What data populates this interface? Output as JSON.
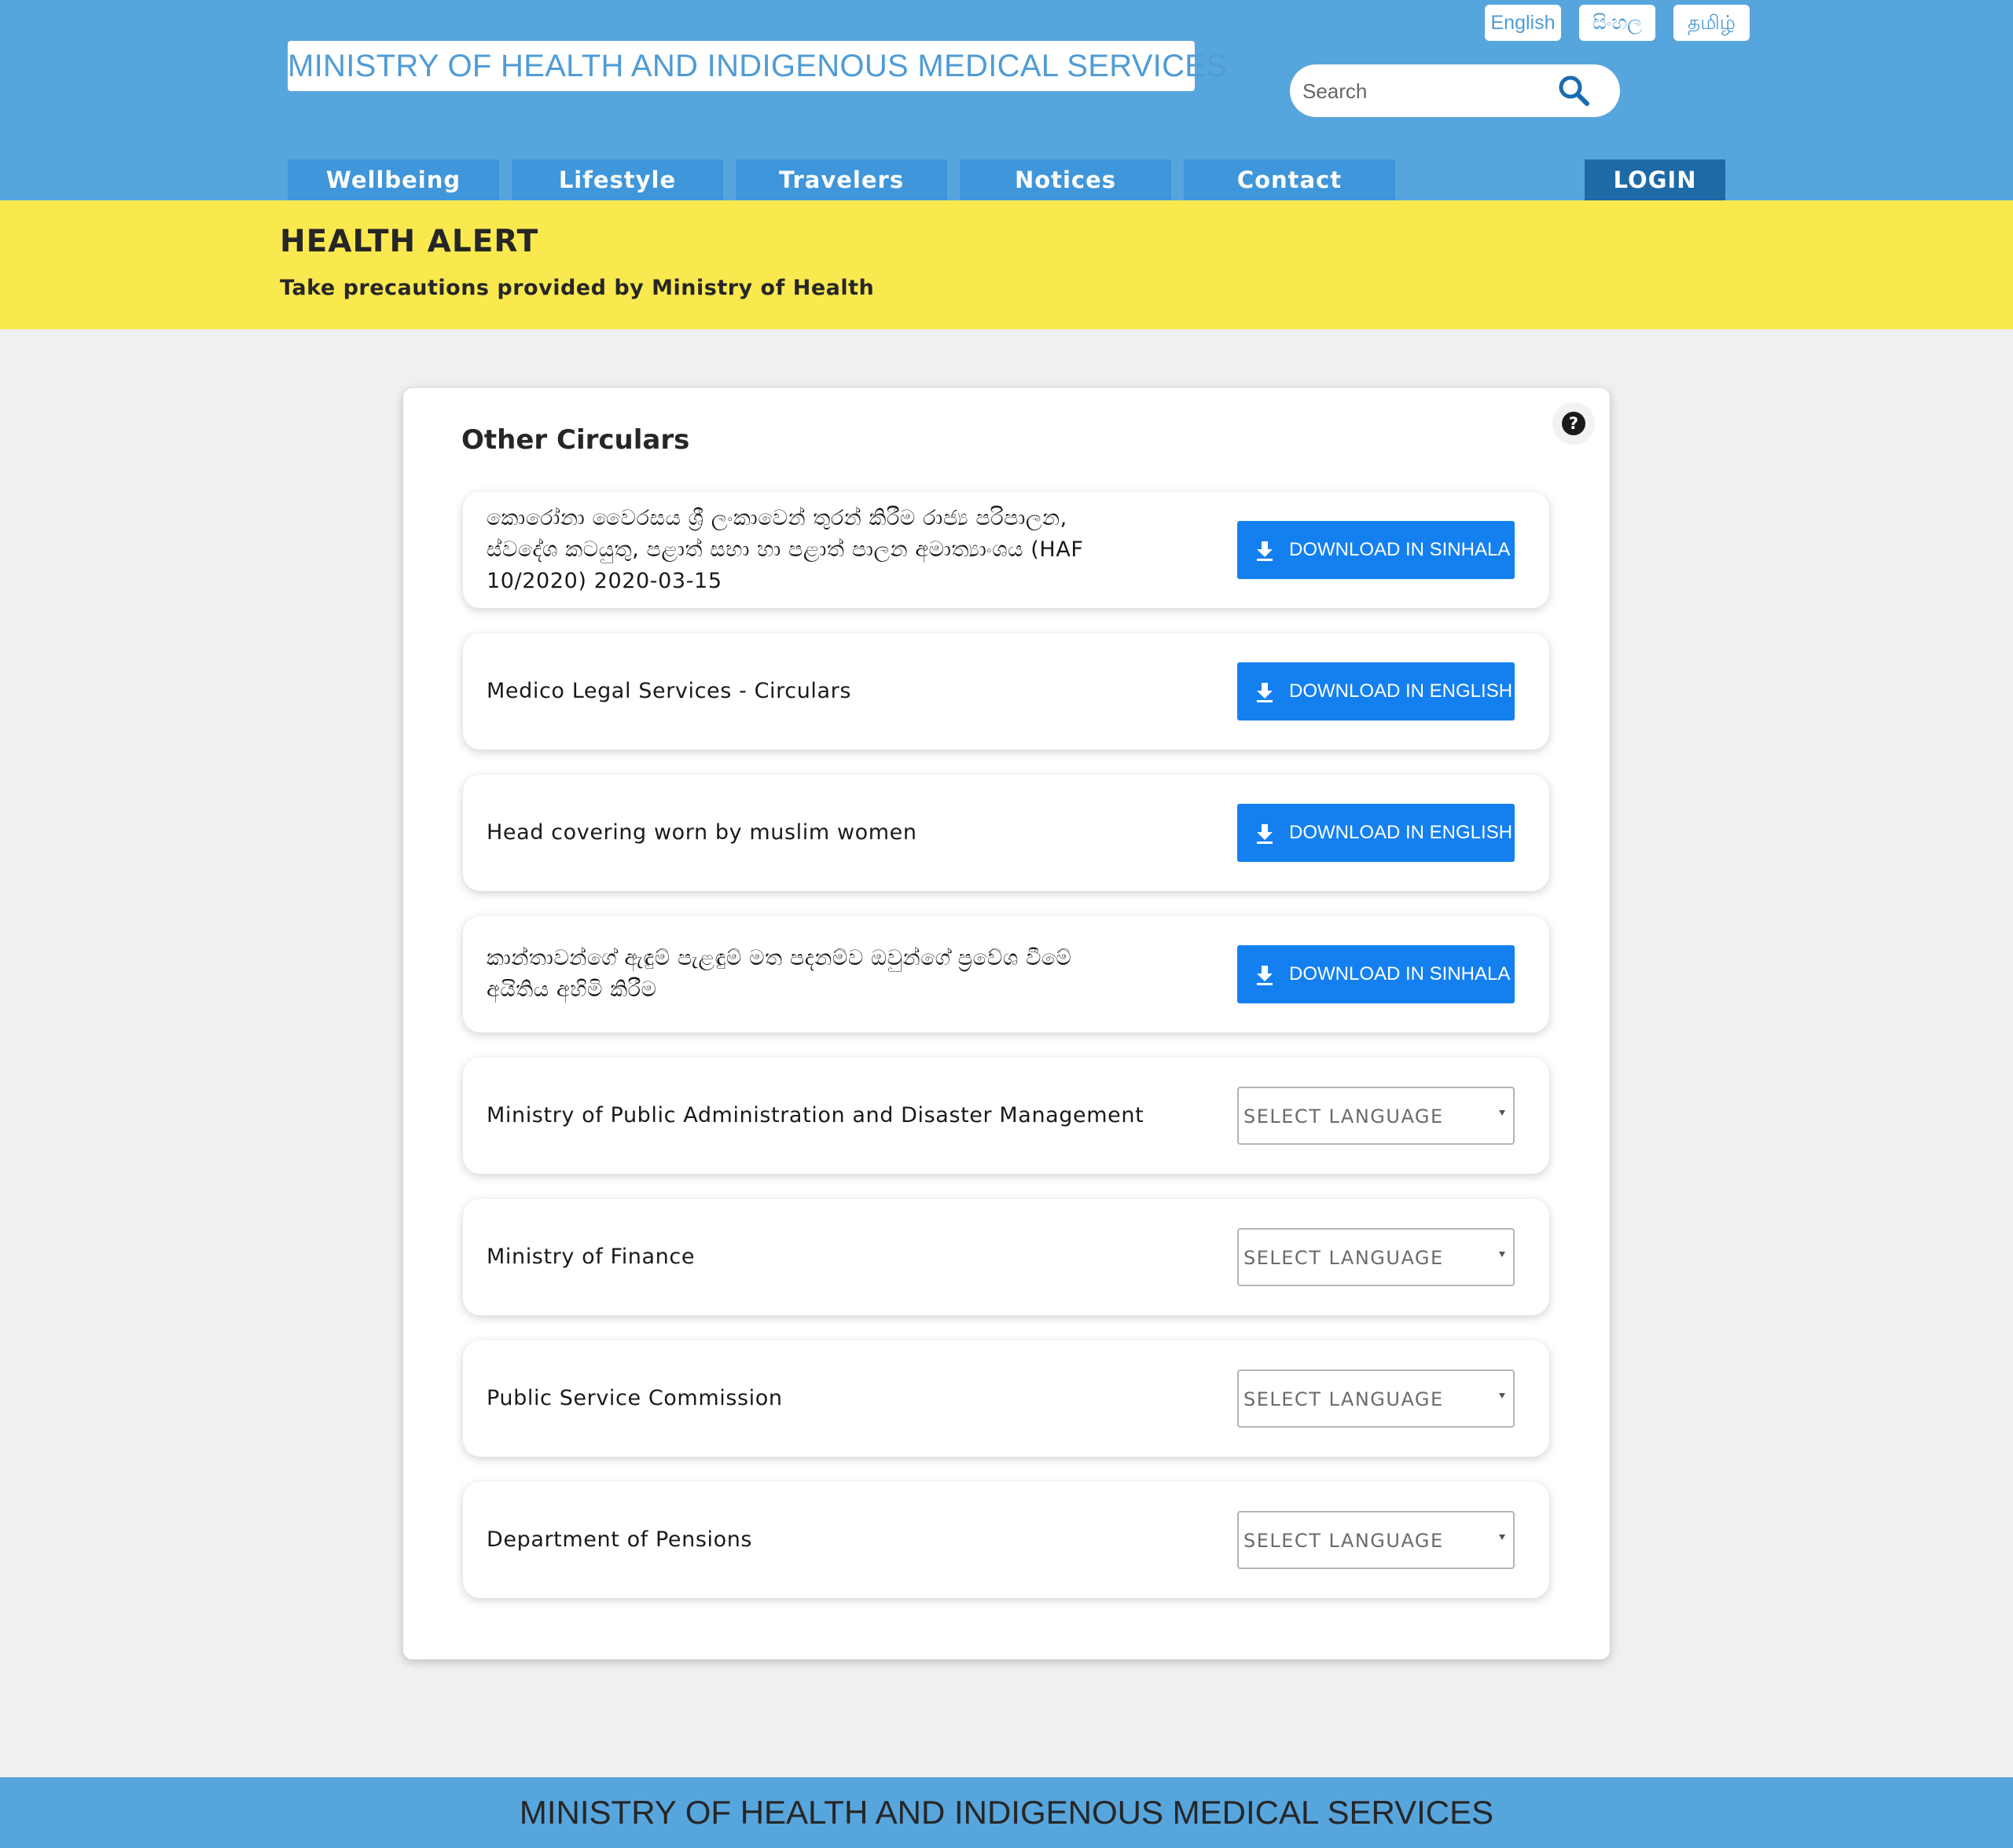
{
  "header": {
    "site_title": "MINISTRY OF HEALTH AND INDIGENOUS MEDICAL SERVICES",
    "languages": [
      "English",
      "සිංහල",
      "தமிழ்"
    ],
    "search": {
      "placeholder": "Search",
      "value": ""
    },
    "nav": [
      "Wellbeing",
      "Lifestyle",
      "Travelers",
      "Notices",
      "Contact"
    ],
    "login": "LOGIN"
  },
  "alert": {
    "title": "HEALTH ALERT",
    "subtitle": "Take precautions provided by Ministry of Health"
  },
  "circulars": {
    "title": "Other Circulars",
    "help_icon": "question-circle-icon",
    "items": [
      {
        "lines": [
          "කොරෝනා වෛරසය ශ්‍රී ලංකාවෙන් තුරන් කිරීම රාජ්‍ය පරිපාලන,",
          "ස්වදේශ කටයුතු, පළාත් සභා හා පළාත් පාලන අමාත්‍යාංශය (HAF",
          "10/2020) 2020-03-15"
        ],
        "action": "DOWNLOAD IN SINHALA"
      },
      {
        "lines": [
          "Medico Legal Services - Circulars"
        ],
        "action": "DOWNLOAD IN ENGLISH"
      },
      {
        "lines": [
          "Head covering worn by muslim women"
        ],
        "action": "DOWNLOAD IN ENGLISH"
      },
      {
        "lines": [
          "කාන්තාවන්ගේ ඇඳුම් පැළඳුම් මත පදනම්ව ඔවුන්ගේ ප්‍රවේශ වීමේ",
          "අයිතිය අහිමි කිරීම"
        ],
        "action": "DOWNLOAD IN SINHALA"
      },
      {
        "lines": [
          "Ministry of Public Administration and Disaster Management"
        ],
        "select": "SELECT LANGUAGE"
      },
      {
        "lines": [
          "Ministry of Finance"
        ],
        "select": "SELECT LANGUAGE"
      },
      {
        "lines": [
          "Public Service Commission"
        ],
        "select": "SELECT LANGUAGE"
      },
      {
        "lines": [
          "Department of Pensions"
        ],
        "select": "SELECT LANGUAGE"
      }
    ]
  },
  "colors": {
    "header_bg": "#57a5dd",
    "nav_bg": "#3f96da",
    "login_bg": "#1d6aa6",
    "alert_bg": "#f9e94f",
    "download_button": "#1480f0"
  },
  "footer": {
    "text": "MINISTRY OF HEALTH AND INDIGENOUS MEDICAL SERVICES"
  }
}
